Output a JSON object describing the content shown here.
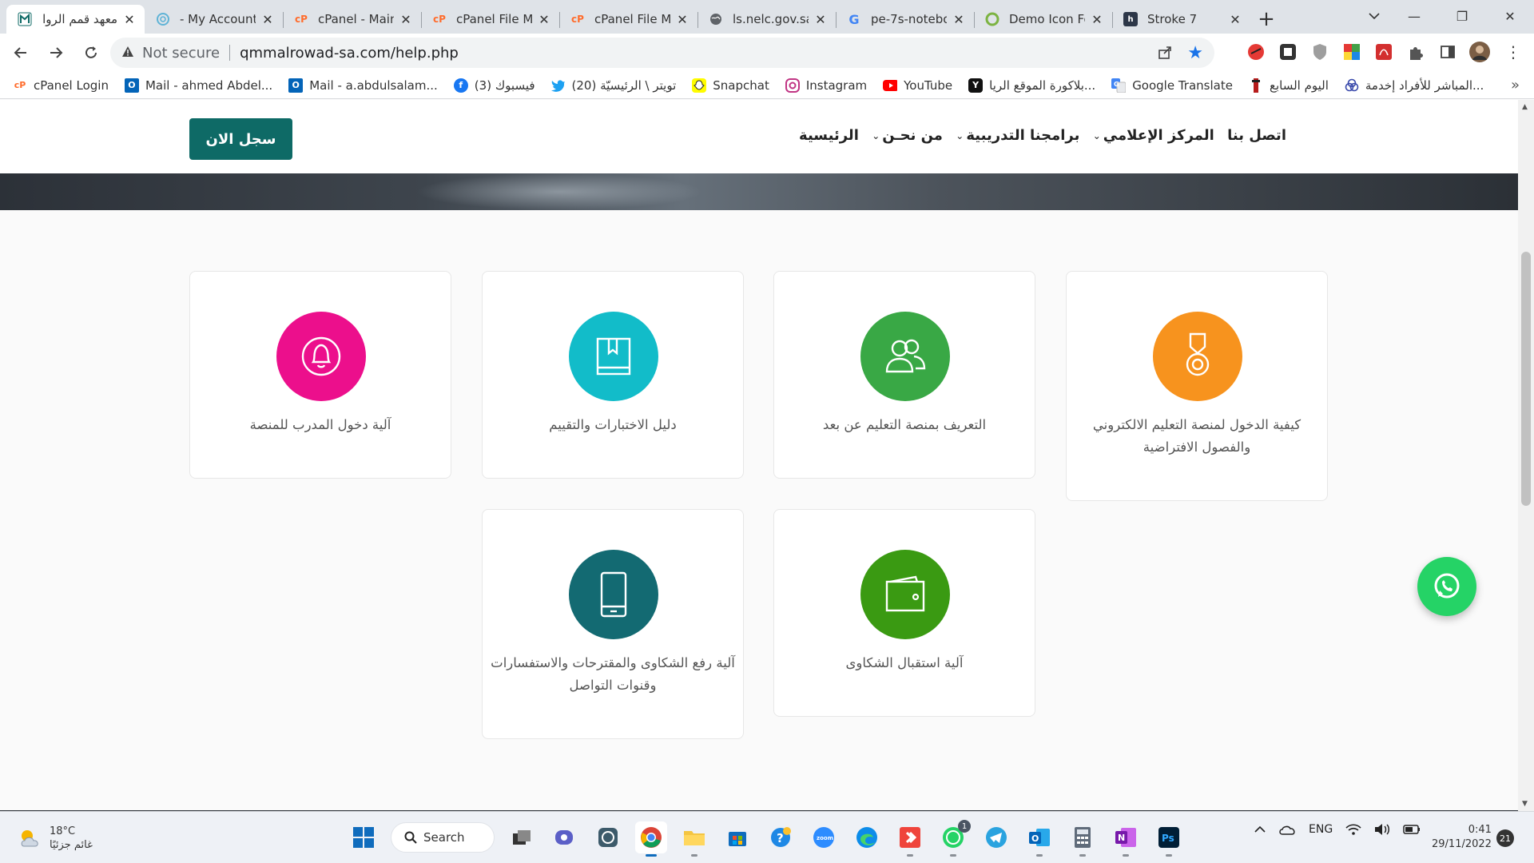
{
  "tabs": [
    {
      "title": "معهد قمم الروا",
      "favicon": "institute-logo",
      "active": true
    },
    {
      "title": "- My Account",
      "favicon": "account-swirl-icon"
    },
    {
      "title": "cPanel - Main",
      "favicon": "cpanel-icon"
    },
    {
      "title": "cPanel File Ma",
      "favicon": "cpanel-icon"
    },
    {
      "title": "cPanel File Ma",
      "favicon": "cpanel-icon"
    },
    {
      "title": "ls.nelc.gov.sa",
      "favicon": "globe-icon"
    },
    {
      "title": "pe-7s-notebo",
      "favicon": "google-icon"
    },
    {
      "title": "Demo Icon Fo",
      "favicon": "demo-icon"
    },
    {
      "title": "Stroke 7",
      "favicon": "stroke7-icon"
    }
  ],
  "address_bar": {
    "security_label": "Not secure",
    "url": "qmmalrowad-sa.com/help.php"
  },
  "bookmarks": [
    {
      "label": "cPanel Login",
      "icon": "cpanel-icon"
    },
    {
      "label": "Mail - ahmed Abdel...",
      "icon": "outlook-icon"
    },
    {
      "label": "Mail - a.abdulsalam...",
      "icon": "outlook-icon"
    },
    {
      "label": "(3) فيسبوك",
      "icon": "facebook-icon"
    },
    {
      "label": "(20) تويتر \\ الرئيسيّة",
      "icon": "twitter-icon"
    },
    {
      "label": "Snapchat",
      "icon": "snapchat-icon"
    },
    {
      "label": "Instagram",
      "icon": "instagram-icon"
    },
    {
      "label": "YouTube",
      "icon": "youtube-icon"
    },
    {
      "label": "بلاكورة الموقع الريا...",
      "icon": "y-icon"
    },
    {
      "label": "Google Translate",
      "icon": "translate-icon"
    },
    {
      "label": "اليوم السابع",
      "icon": "news-icon"
    },
    {
      "label": "المباشر للأفراد إخدمة...",
      "icon": "bank-icon"
    }
  ],
  "site": {
    "cta_label": "سجل الان",
    "menu": [
      {
        "label": "الرئيسية",
        "has_dropdown": false
      },
      {
        "label": "من نحـن",
        "has_dropdown": true
      },
      {
        "label": "برامجنا التدريبية",
        "has_dropdown": true
      },
      {
        "label": "المركز الإعلامي",
        "has_dropdown": true
      },
      {
        "label": "اتصل بنا",
        "has_dropdown": false
      }
    ],
    "cards": [
      {
        "text": "كيفية الدخول لمنصة التعليم الالكتروني والفصول الافتراضية",
        "icon": "medal-icon",
        "color": "#f7931e"
      },
      {
        "text": "التعريف بمنصة التعليم عن بعد",
        "icon": "users-icon",
        "color": "#39a845"
      },
      {
        "text": "دليل الاختبارات والتقييم",
        "icon": "book-icon",
        "color": "#12bcc9"
      },
      {
        "text": "آلية دخول المدرب للمنصة",
        "icon": "bell-icon",
        "color": "#ec0f8c"
      },
      {
        "text": "آلية استقبال الشكاوى",
        "icon": "wallet-icon",
        "color": "#3a9a12"
      },
      {
        "text": "آلية رفع الشكاوى والمقترحات والاستفسارات وقنوات التواصل",
        "icon": "phone-icon",
        "color": "#136a72"
      }
    ]
  },
  "taskbar": {
    "weather_temp": "18°C",
    "weather_desc": "غائم جزئيًا",
    "search_label": "Search",
    "apps": [
      "start-icon",
      "taskview-icon",
      "teams-icon",
      "app-icon",
      "chrome-icon",
      "explorer-icon",
      "store-icon",
      "help-icon",
      "zoom-icon",
      "edge-icon",
      "anydesk-icon",
      "whatsapp-icon",
      "telegram-icon",
      "outlook-icon",
      "calculator-icon",
      "onenote-icon",
      "photoshop-icon"
    ],
    "whatsapp_badge": "1",
    "language": "ENG",
    "time": "0:41",
    "date": "29/11/2022",
    "notifications": "21"
  }
}
